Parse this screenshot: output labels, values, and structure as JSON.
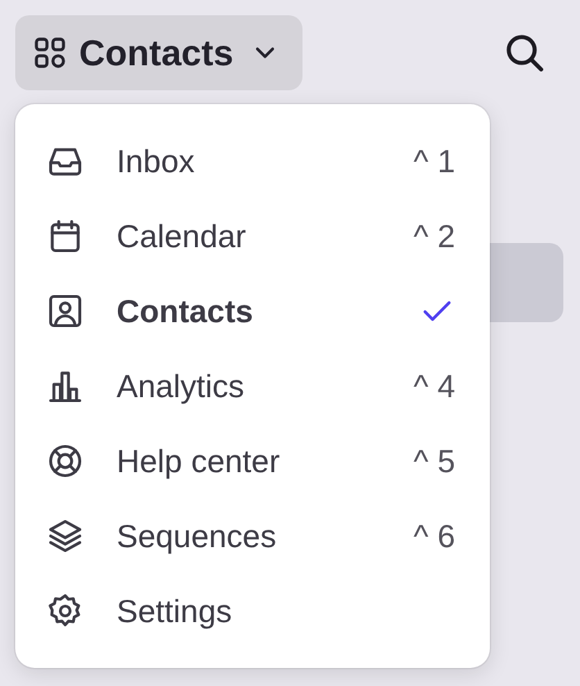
{
  "header": {
    "title": "Contacts"
  },
  "menu": {
    "items": [
      {
        "label": "Inbox",
        "shortcut": "^ 1",
        "selected": false
      },
      {
        "label": "Calendar",
        "shortcut": "^ 2",
        "selected": false
      },
      {
        "label": "Contacts",
        "selected": true
      },
      {
        "label": "Analytics",
        "shortcut": "^ 4",
        "selected": false
      },
      {
        "label": "Help center",
        "shortcut": "^ 5",
        "selected": false
      },
      {
        "label": "Sequences",
        "shortcut": "^ 6",
        "selected": false
      },
      {
        "label": "Settings",
        "selected": false
      }
    ]
  }
}
